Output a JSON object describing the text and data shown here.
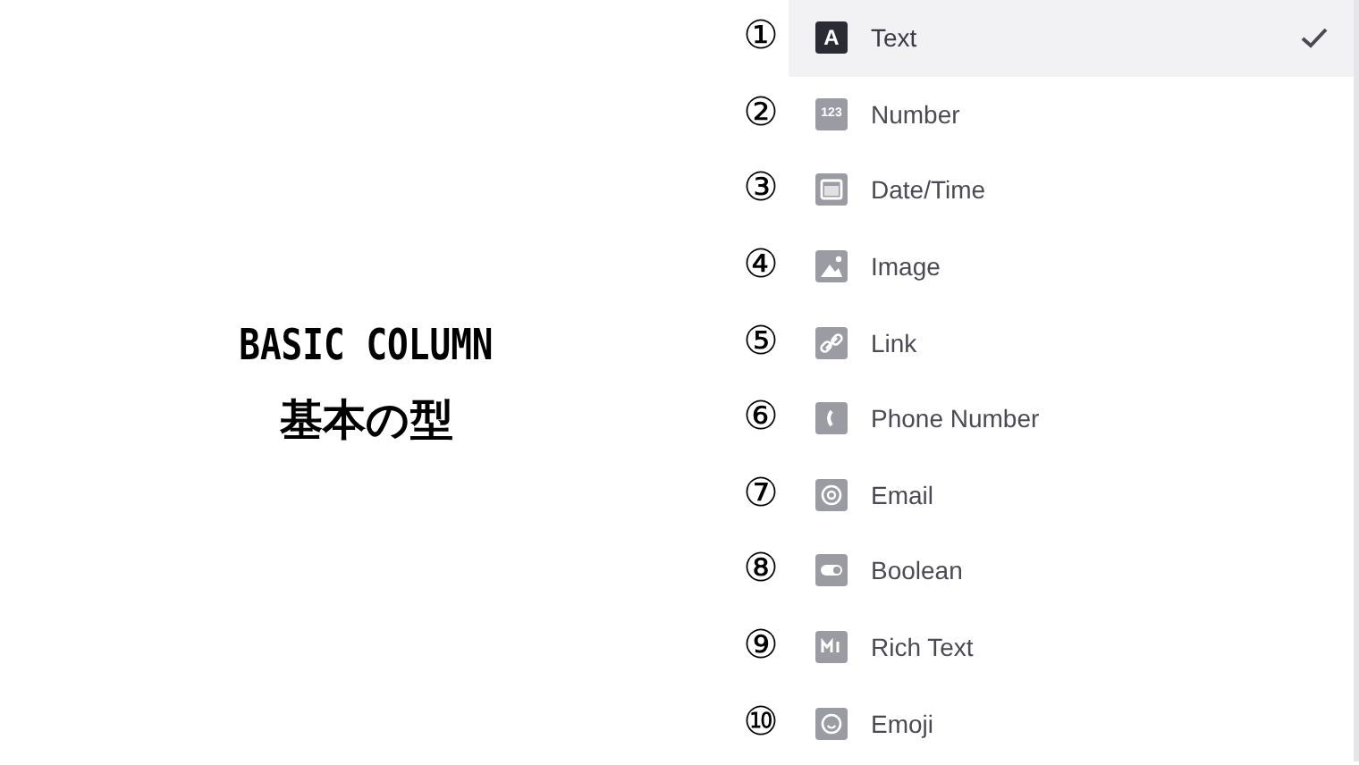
{
  "heading": {
    "title": "BASIC COLUMN",
    "subtitle": "基本の型"
  },
  "menu": {
    "items": [
      {
        "marker": "①",
        "kind": "text",
        "icon_text": "A",
        "label": "Text",
        "selected": true
      },
      {
        "marker": "②",
        "kind": "number",
        "icon_text": "123",
        "label": "Number",
        "selected": false
      },
      {
        "marker": "③",
        "kind": "datetime",
        "label": "Date/Time",
        "selected": false
      },
      {
        "marker": "④",
        "kind": "image",
        "label": "Image",
        "selected": false
      },
      {
        "marker": "⑤",
        "kind": "link",
        "label": "Link",
        "selected": false
      },
      {
        "marker": "⑥",
        "kind": "phone",
        "label": "Phone Number",
        "selected": false
      },
      {
        "marker": "⑦",
        "kind": "email",
        "label": "Email",
        "selected": false
      },
      {
        "marker": "⑧",
        "kind": "boolean",
        "label": "Boolean",
        "selected": false
      },
      {
        "marker": "⑨",
        "kind": "richtext",
        "label": "Rich Text",
        "selected": false
      },
      {
        "marker": "⑩",
        "kind": "emoji",
        "label": "Emoji",
        "selected": false
      }
    ]
  }
}
